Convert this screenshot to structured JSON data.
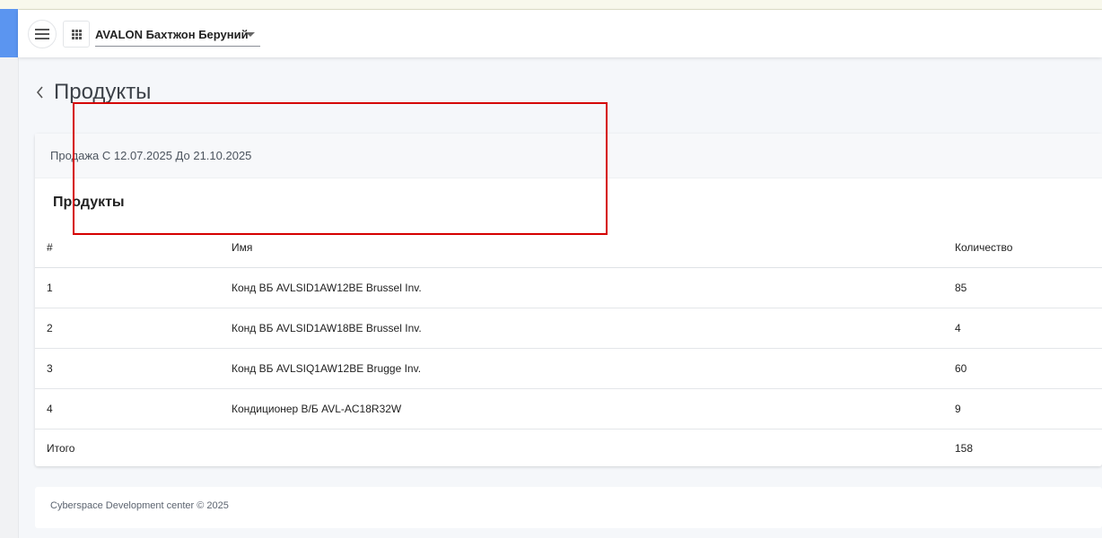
{
  "header": {
    "company_name": "AVALON Бахтжон Беруний",
    "menu_icon": "hamburger-menu-icon",
    "apps_icon": "apps-grid-icon",
    "dropdown_icon": "caret-down-icon"
  },
  "page": {
    "title": "Продукты",
    "back_icon": "chevron-left-icon"
  },
  "report": {
    "period_text": "Продажа С 12.07.2025 До 21.10.2025",
    "table_title": "Продукты",
    "columns": [
      "#",
      "Имя",
      "Количество"
    ],
    "rows": [
      {
        "num": "1",
        "name": "Конд ВБ AVLSID1AW12BE Brussel Inv.",
        "qty": "85"
      },
      {
        "num": "2",
        "name": "Конд ВБ AVLSID1AW18BE Brussel Inv.",
        "qty": "4"
      },
      {
        "num": "3",
        "name": "Конд ВБ AVLSIQ1AW12BE Brugge Inv.",
        "qty": "60"
      },
      {
        "num": "4",
        "name": "Кондиционер В/Б AVL-AC18R32W",
        "qty": "9"
      }
    ],
    "total": {
      "label": "Итого",
      "qty": "158"
    }
  },
  "footer": {
    "text": "Cyberspace Development center © 2025"
  },
  "colors": {
    "accent": "#5b95f0",
    "highlight": "#d50000"
  }
}
